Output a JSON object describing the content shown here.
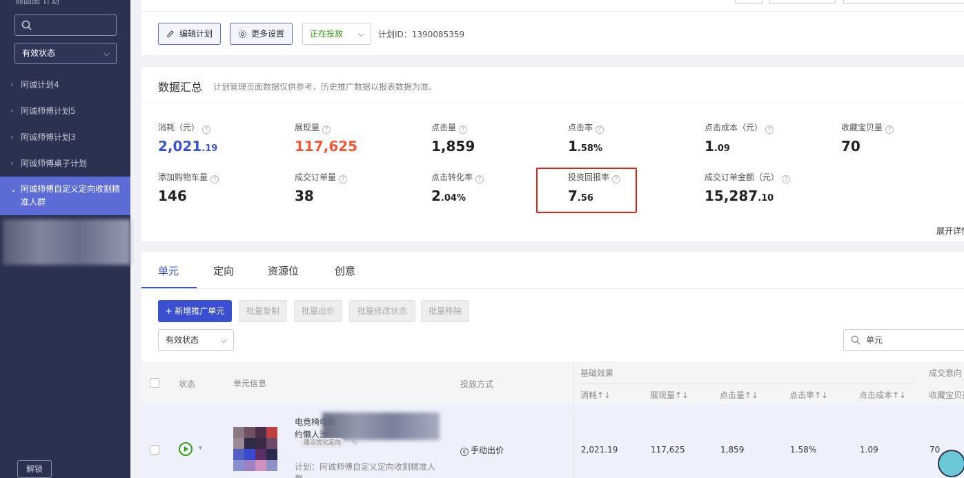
{
  "sidebar": {
    "crumb": "商品图 计划",
    "search_placeholder": "",
    "status_select": "有效状态",
    "items": [
      {
        "label": "阿诚计划4"
      },
      {
        "label": "阿诚师傅计划5"
      },
      {
        "label": "阿诚师傅计划3"
      },
      {
        "label": "阿诚师傅桌子计划"
      },
      {
        "label": "阿诚师傅自定义定向收割精准人群"
      }
    ],
    "unlock_label": "解锁"
  },
  "plan_toolbar": {
    "edit_label": "编辑计划",
    "settings_label": "更多设置",
    "status_value": "正在投放",
    "plan_id": "计划ID：1390085359"
  },
  "summary": {
    "title": "数据汇总",
    "note": "计划管理页面数据仅供参考，历史推广数据以报表数据为准。",
    "expand_label": "展开详情",
    "metrics": [
      {
        "label": "消耗（元）",
        "int": "2,021",
        "dec": ".19"
      },
      {
        "label": "展现量",
        "int": "117,625",
        "dec": ""
      },
      {
        "label": "点击量",
        "int": "1,859",
        "dec": ""
      },
      {
        "label": "点击率",
        "int": "1",
        "dec": ".58%"
      },
      {
        "label": "点击成本（元）",
        "int": "1",
        "dec": ".09"
      },
      {
        "label": "收藏宝贝量",
        "int": "70",
        "dec": ""
      },
      {
        "label": "添加购物车量",
        "int": "146",
        "dec": ""
      },
      {
        "label": "成交订单量",
        "int": "38",
        "dec": ""
      },
      {
        "label": "点击转化率",
        "int": "2",
        "dec": ".04%"
      },
      {
        "label": "投资回报率",
        "int": "7",
        "dec": ".56"
      },
      {
        "label": "成交订单金额（元）",
        "int": "15,287",
        "dec": ".10"
      }
    ]
  },
  "tabs": [
    "单元",
    "定向",
    "资源位",
    "创意"
  ],
  "actions": {
    "add_label": "+ 新增推广单元",
    "batch_copy": "批量复制",
    "batch_bid": "批量出价",
    "batch_status": "批量修改状态",
    "batch_remove": "批量移除",
    "filter_value": "有效状态",
    "search_value": "单元"
  },
  "table": {
    "headers": {
      "status": "状态",
      "unit_info": "单元信息",
      "delivery": "投放方式",
      "group_basic": "基础效果",
      "group_conv": "成交意向",
      "cost": "消耗↑↓",
      "impressions": "展现量↑↓",
      "clicks": "点击量↑↓",
      "ctr": "点击率↑↓",
      "cpc": "点击成本↑↓",
      "fav": "收藏宝贝量"
    },
    "rows": [
      {
        "title_line1": "电竞椅电脑",
        "title_line2": "约懒人沙",
        "tag": "建议优化定向",
        "plan": "计划：阿诚师傅自定义定向收割精准人",
        "plan_line2": "群",
        "delivery": "手动出价",
        "cost": "2,021.19",
        "impressions": "117,625",
        "clicks": "1,859",
        "ctr": "1.58%",
        "cpc": "1.09",
        "fav": "70"
      }
    ]
  },
  "colors": {
    "accent": "#3b4fd1",
    "sidebar": "#2b3150",
    "sidebar_active": "#5b6cd6",
    "highlight": "#e0241a",
    "status_green": "#3a9d1a",
    "impression_red": "#f05a3a"
  }
}
